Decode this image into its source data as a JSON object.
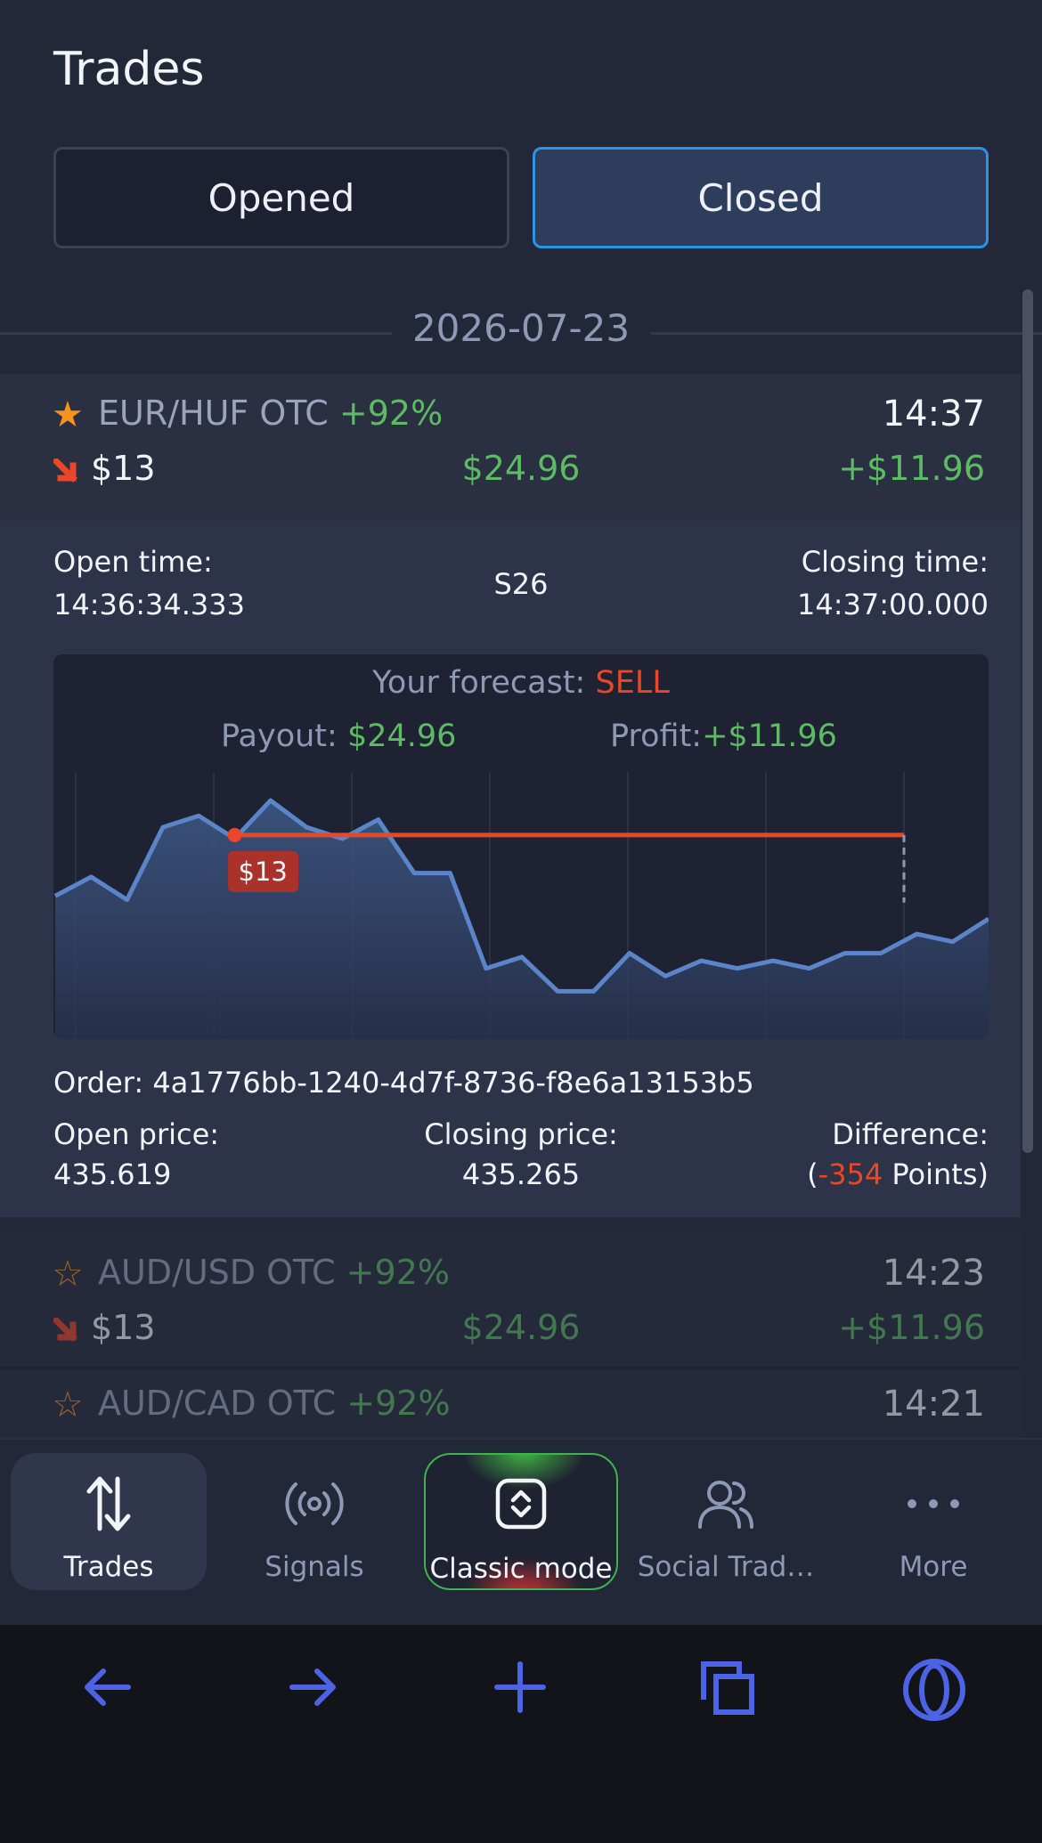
{
  "header": {
    "title": "Trades"
  },
  "tabs": [
    {
      "label": "Opened",
      "active": false
    },
    {
      "label": "Closed",
      "active": true
    }
  ],
  "date_group": "2026-07-23",
  "trades": [
    {
      "pair": "EUR/HUF OTC",
      "percent": "+92%",
      "time": "14:37",
      "direction": "down",
      "amount": "$13",
      "payout": "$24.96",
      "profit": "+$11.96",
      "favorite": true
    },
    {
      "pair": "AUD/USD OTC",
      "percent": "+92%",
      "time": "14:23",
      "direction": "down",
      "amount": "$13",
      "payout": "$24.96",
      "profit": "+$11.96",
      "favorite": false
    },
    {
      "pair": "AUD/CAD OTC",
      "percent": "+92%",
      "time": "14:21",
      "favorite": false
    }
  ],
  "detail": {
    "open_time_label": "Open time:",
    "open_time": "14:36:34.333",
    "duration": "S26",
    "closing_time_label": "Closing time:",
    "closing_time": "14:37:00.000",
    "forecast_label": "Your forecast: ",
    "forecast_value": "SELL",
    "payout_label": "Payout: ",
    "payout_value": "$24.96",
    "profit_label": "Profit:",
    "profit_value": "+$11.96",
    "entry_badge": "$13",
    "order_label": "Order: ",
    "order_id": "4a1776bb-1240-4d7f-8736-f8e6a13153b5",
    "open_price_label": "Open price:",
    "open_price": "435.619",
    "closing_price_label": "Closing price:",
    "closing_price": "435.265",
    "difference_label": "Difference:",
    "difference_open": "(",
    "difference_value": "-354",
    "difference_unit": " Points)"
  },
  "price_chart": {
    "entry_price": 435.619,
    "close_price": 435.265,
    "prices": [
      435.3,
      435.4,
      435.28,
      435.66,
      435.72,
      435.6,
      435.8,
      435.66,
      435.6,
      435.7,
      435.42,
      435.42,
      434.92,
      434.98,
      434.8,
      434.8,
      435.0,
      434.88,
      434.96,
      434.92,
      434.96,
      434.92,
      435.0,
      435.0,
      435.1,
      435.06,
      435.18
    ]
  },
  "bottom_nav": [
    {
      "label": "Trades",
      "icon": "arrows-up-down-icon",
      "active": true
    },
    {
      "label": "Signals",
      "icon": "broadcast-icon",
      "active": false
    },
    {
      "label": "Classic mode",
      "icon": "mode-toggle-icon",
      "active": false
    },
    {
      "label": "Social Trad…",
      "icon": "users-icon",
      "active": false
    },
    {
      "label": "More",
      "icon": "more-dots-icon",
      "active": false
    }
  ],
  "browser_bar": [
    "back-arrow-icon",
    "forward-arrow-icon",
    "new-tab-plus-icon",
    "tabs-icon",
    "opera-logo-icon"
  ],
  "colors": {
    "accent_blue": "#2c94e6",
    "profit_green": "#5dbb63",
    "sell_red": "#e9462a",
    "star_orange": "#f7941d",
    "browser_icon_blue": "#4d63e6"
  }
}
